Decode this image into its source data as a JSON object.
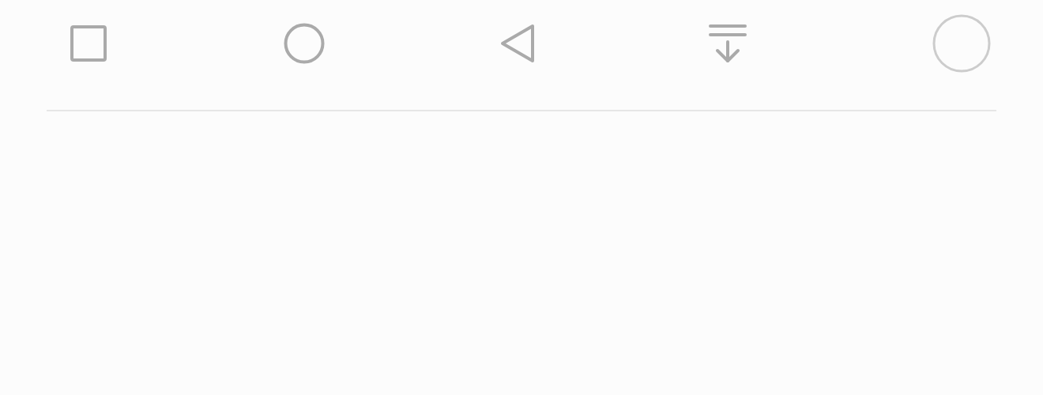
{
  "navigation_bar": {
    "buttons": [
      {
        "kind": "square"
      },
      {
        "kind": "circle"
      },
      {
        "kind": "triangle"
      },
      {
        "kind": "download"
      },
      {
        "kind": "ring"
      }
    ]
  }
}
